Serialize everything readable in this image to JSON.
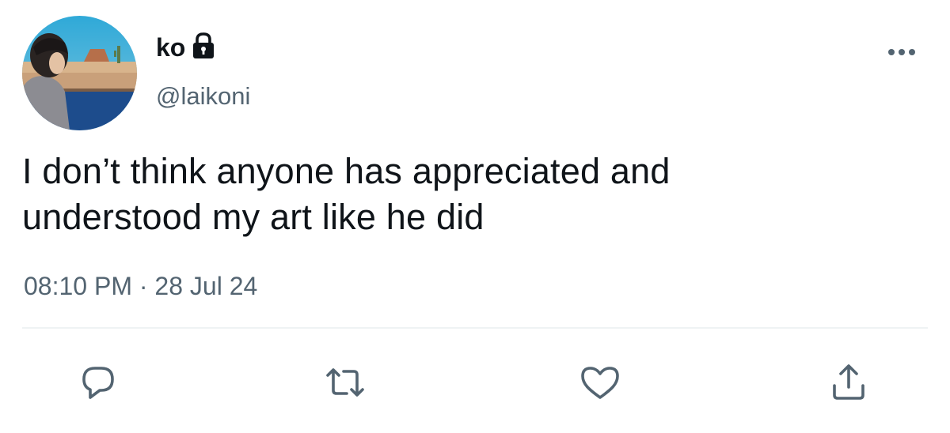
{
  "author": {
    "display_name": "ko",
    "handle": "@laikoni",
    "protected_icon": "lock-icon",
    "avatar": "profile-photo"
  },
  "menu": {
    "icon": "more-horizontal-icon"
  },
  "tweet": {
    "text_lines": [
      "I don’t think anyone has appreciated and",
      "understood my art like he did"
    ],
    "timestamp": "08:10 PM · 28 Jul 24"
  },
  "actions": [
    {
      "name": "reply",
      "icon": "reply-icon"
    },
    {
      "name": "retweet",
      "icon": "retweet-icon"
    },
    {
      "name": "like",
      "icon": "heart-icon"
    },
    {
      "name": "share",
      "icon": "share-icon"
    }
  ],
  "colors": {
    "text_primary": "#0f1419",
    "text_secondary": "#536471",
    "icon": "#536471",
    "divider": "#eff3f4"
  }
}
